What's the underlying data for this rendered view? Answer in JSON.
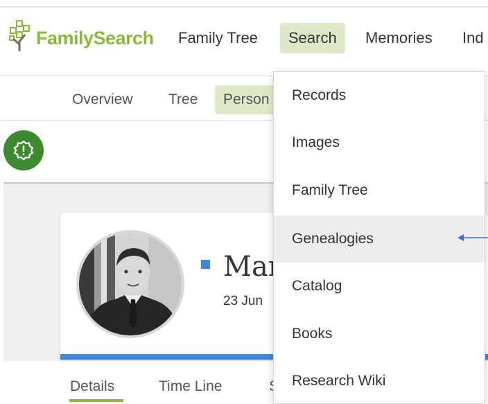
{
  "header": {
    "logo_text": "FamilySearch",
    "nav": [
      "Family Tree",
      "Search",
      "Memories",
      "Ind"
    ],
    "active_nav": "Search"
  },
  "subnav": {
    "items": [
      "Overview",
      "Tree",
      "Person"
    ],
    "active": "Person"
  },
  "person": {
    "name": "Mar",
    "dates": "23 Jun"
  },
  "tabs": [
    "Details",
    "Time Line",
    "S"
  ],
  "active_tab": "Details",
  "search_menu": {
    "items": [
      "Records",
      "Images",
      "Family Tree",
      "Genealogies",
      "Catalog",
      "Books",
      "Research Wiki"
    ],
    "highlighted": "Genealogies"
  },
  "colors": {
    "brand_green": "#8cb83f",
    "active_bg": "#dfe9c9",
    "alert_green": "#3c8c2f",
    "accent_blue": "#3e87e0"
  },
  "icons": {
    "alert": "alert-circle-icon",
    "annotation_arrow": "arrow-left-icon"
  }
}
